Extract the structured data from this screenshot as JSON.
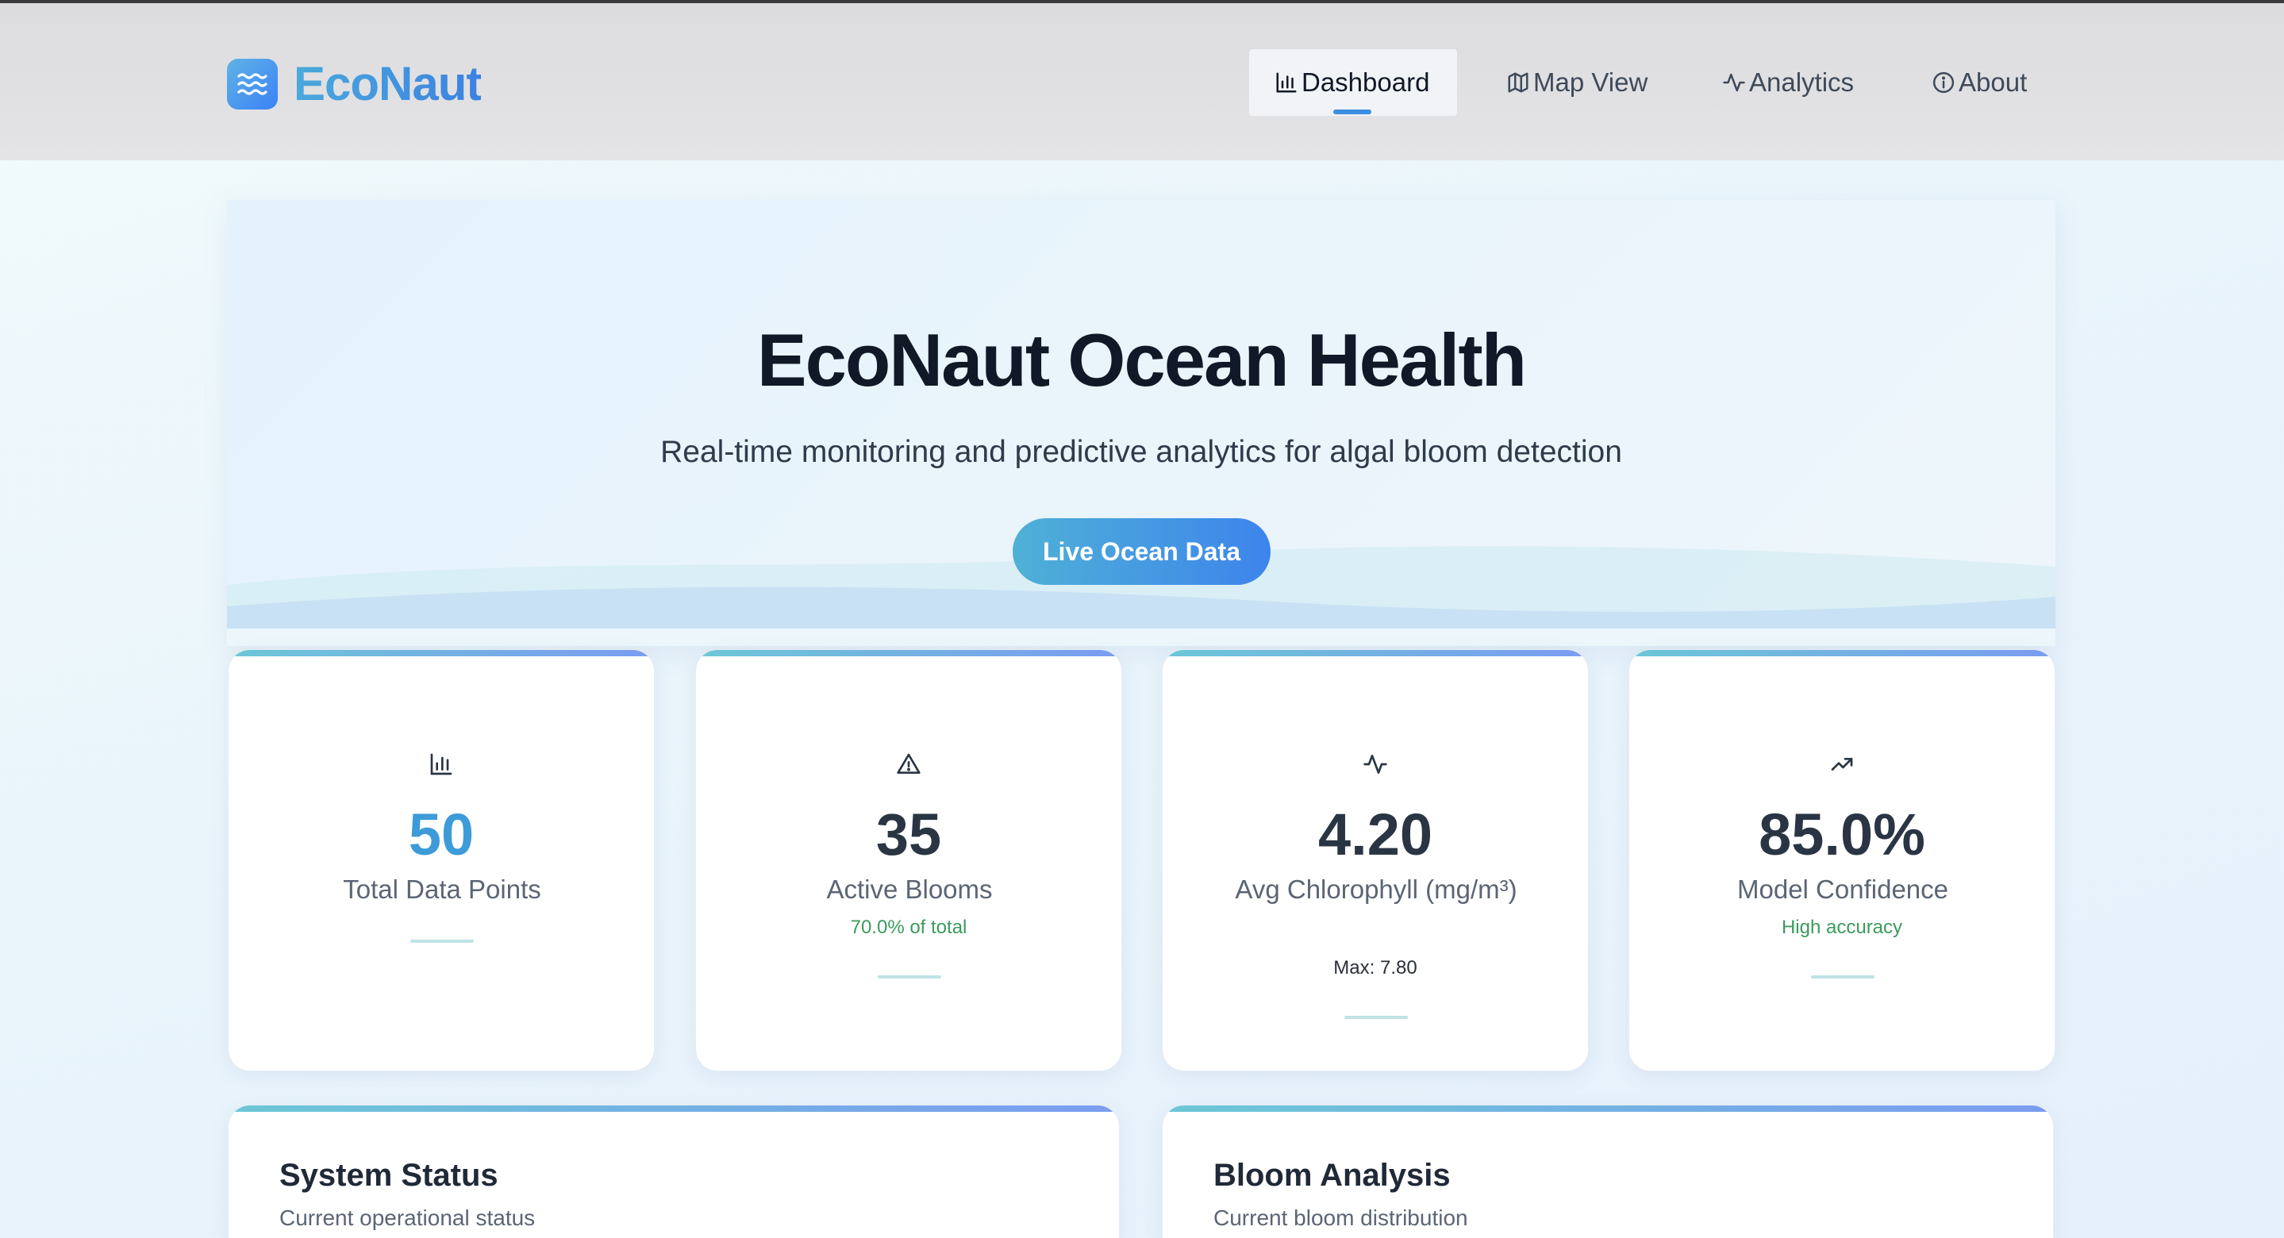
{
  "brand": {
    "name": "EcoNaut",
    "logo_icon": "waves-icon",
    "accent": "#3b82f6"
  },
  "nav": {
    "items": [
      {
        "label": "Dashboard",
        "icon": "bar-chart-icon",
        "active": true
      },
      {
        "label": "Map View",
        "icon": "map-icon",
        "active": false
      },
      {
        "label": "Analytics",
        "icon": "activity-icon",
        "active": false
      },
      {
        "label": "About",
        "icon": "info-icon",
        "active": false
      }
    ]
  },
  "hero": {
    "title": "EcoNaut Ocean Health",
    "subtitle": "Real-time monitoring and predictive analytics for algal bloom detection",
    "button_label": "Live Ocean Data"
  },
  "stats": [
    {
      "icon": "bar-chart-icon",
      "value": "50",
      "label": "Total Data Points",
      "sub": ""
    },
    {
      "icon": "alert-triangle-icon",
      "value": "35",
      "label": "Active Blooms",
      "sub": "70.0% of total"
    },
    {
      "icon": "activity-icon",
      "value": "4.20",
      "label": "Avg Chlorophyll (mg/m³)",
      "sub": "Max: 7.80"
    },
    {
      "icon": "trending-up-icon",
      "value": "85.0%",
      "label": "Model Confidence",
      "sub": "High accuracy"
    }
  ],
  "panels": [
    {
      "title": "System Status",
      "subtitle": "Current operational status"
    },
    {
      "title": "Bloom Analysis",
      "subtitle": "Current bloom distribution"
    }
  ]
}
